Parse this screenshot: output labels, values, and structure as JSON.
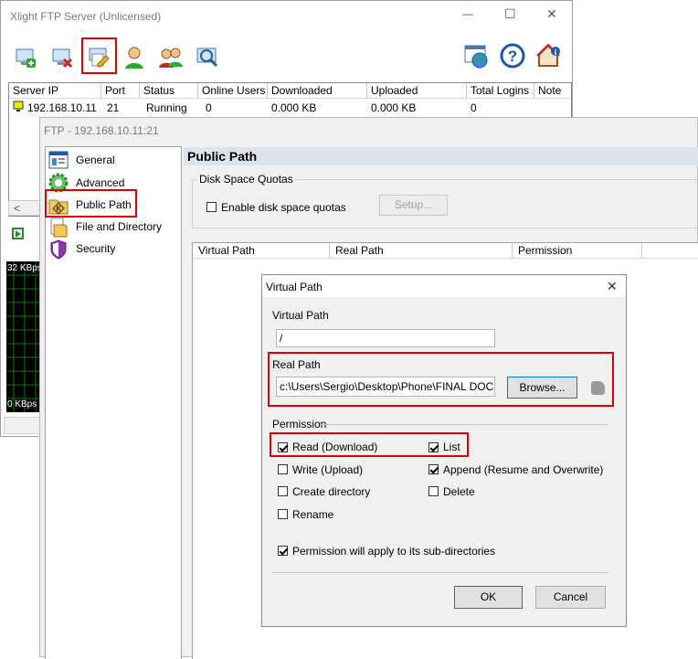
{
  "main_window": {
    "title": "Xlight FTP Server (Unlicensed)",
    "controls": {
      "minimize": "—",
      "maximize": "☐",
      "close": "✕"
    },
    "toolbar_icons": [
      "add-server-icon",
      "delete-server-icon",
      "edit-server-icon",
      "user-icon",
      "users-icon",
      "search-icon",
      "web-icon",
      "help-icon",
      "home-info-icon"
    ],
    "columns": [
      "Server IP",
      "Port",
      "Status",
      "Online Users",
      "Downloaded",
      "Uploaded",
      "Total Logins",
      "Note"
    ],
    "row": {
      "ip": "192.168.10.11",
      "port": "21",
      "status": "Running",
      "online_users": "0",
      "downloaded": "0.000 KB",
      "uploaded": "0.000 KB",
      "total_logins": "0",
      "note": ""
    },
    "graph": {
      "top_label": "32 KBps",
      "bottom_label": "0 KBps"
    },
    "scroll_left": "<"
  },
  "ftp_window": {
    "title": "FTP - 192.168.10.11:21",
    "nav": [
      {
        "label": "General",
        "icon": "general-icon"
      },
      {
        "label": "Advanced",
        "icon": "gear-icon"
      },
      {
        "label": "Public Path",
        "icon": "public-path-icon"
      },
      {
        "label": "File and Directory",
        "icon": "file-directory-icon"
      },
      {
        "label": "Security",
        "icon": "shield-icon"
      }
    ],
    "section_title": "Public Path",
    "quota_group_label": "Disk Space Quotas",
    "enable_quota_label": "Enable disk space quotas",
    "setup_button": "Setup...",
    "path_columns": [
      "Virtual Path",
      "Real Path",
      "Permission"
    ]
  },
  "dialog": {
    "title": "Virtual Path",
    "close": "✕",
    "virtual_path_label": "Virtual Path",
    "virtual_path_value": "/",
    "real_path_label": "Real Path",
    "real_path_value": "c:\\Users\\Sergio\\Desktop\\Phone\\FINAL DOCUMENTS",
    "browse_button": "Browse...",
    "permission_label": "Permission",
    "permissions": {
      "read": {
        "label": "Read (Download)",
        "checked": true
      },
      "list": {
        "label": "List",
        "checked": true
      },
      "write": {
        "label": "Write (Upload)",
        "checked": false
      },
      "append": {
        "label": "Append (Resume and Overwrite)",
        "checked": true
      },
      "create_dir": {
        "label": "Create directory",
        "checked": false
      },
      "delete": {
        "label": "Delete",
        "checked": false
      },
      "rename": {
        "label": "Rename",
        "checked": false
      }
    },
    "subdirs": {
      "label": "Permission will apply to its sub-directories",
      "checked": true
    },
    "ok_button": "OK",
    "cancel_button": "Cancel"
  },
  "colors": {
    "highlight": "#e00000",
    "graph_bg": "#000000",
    "graph_grid": "#0a7a0a",
    "section_header": "#dde3ec"
  }
}
